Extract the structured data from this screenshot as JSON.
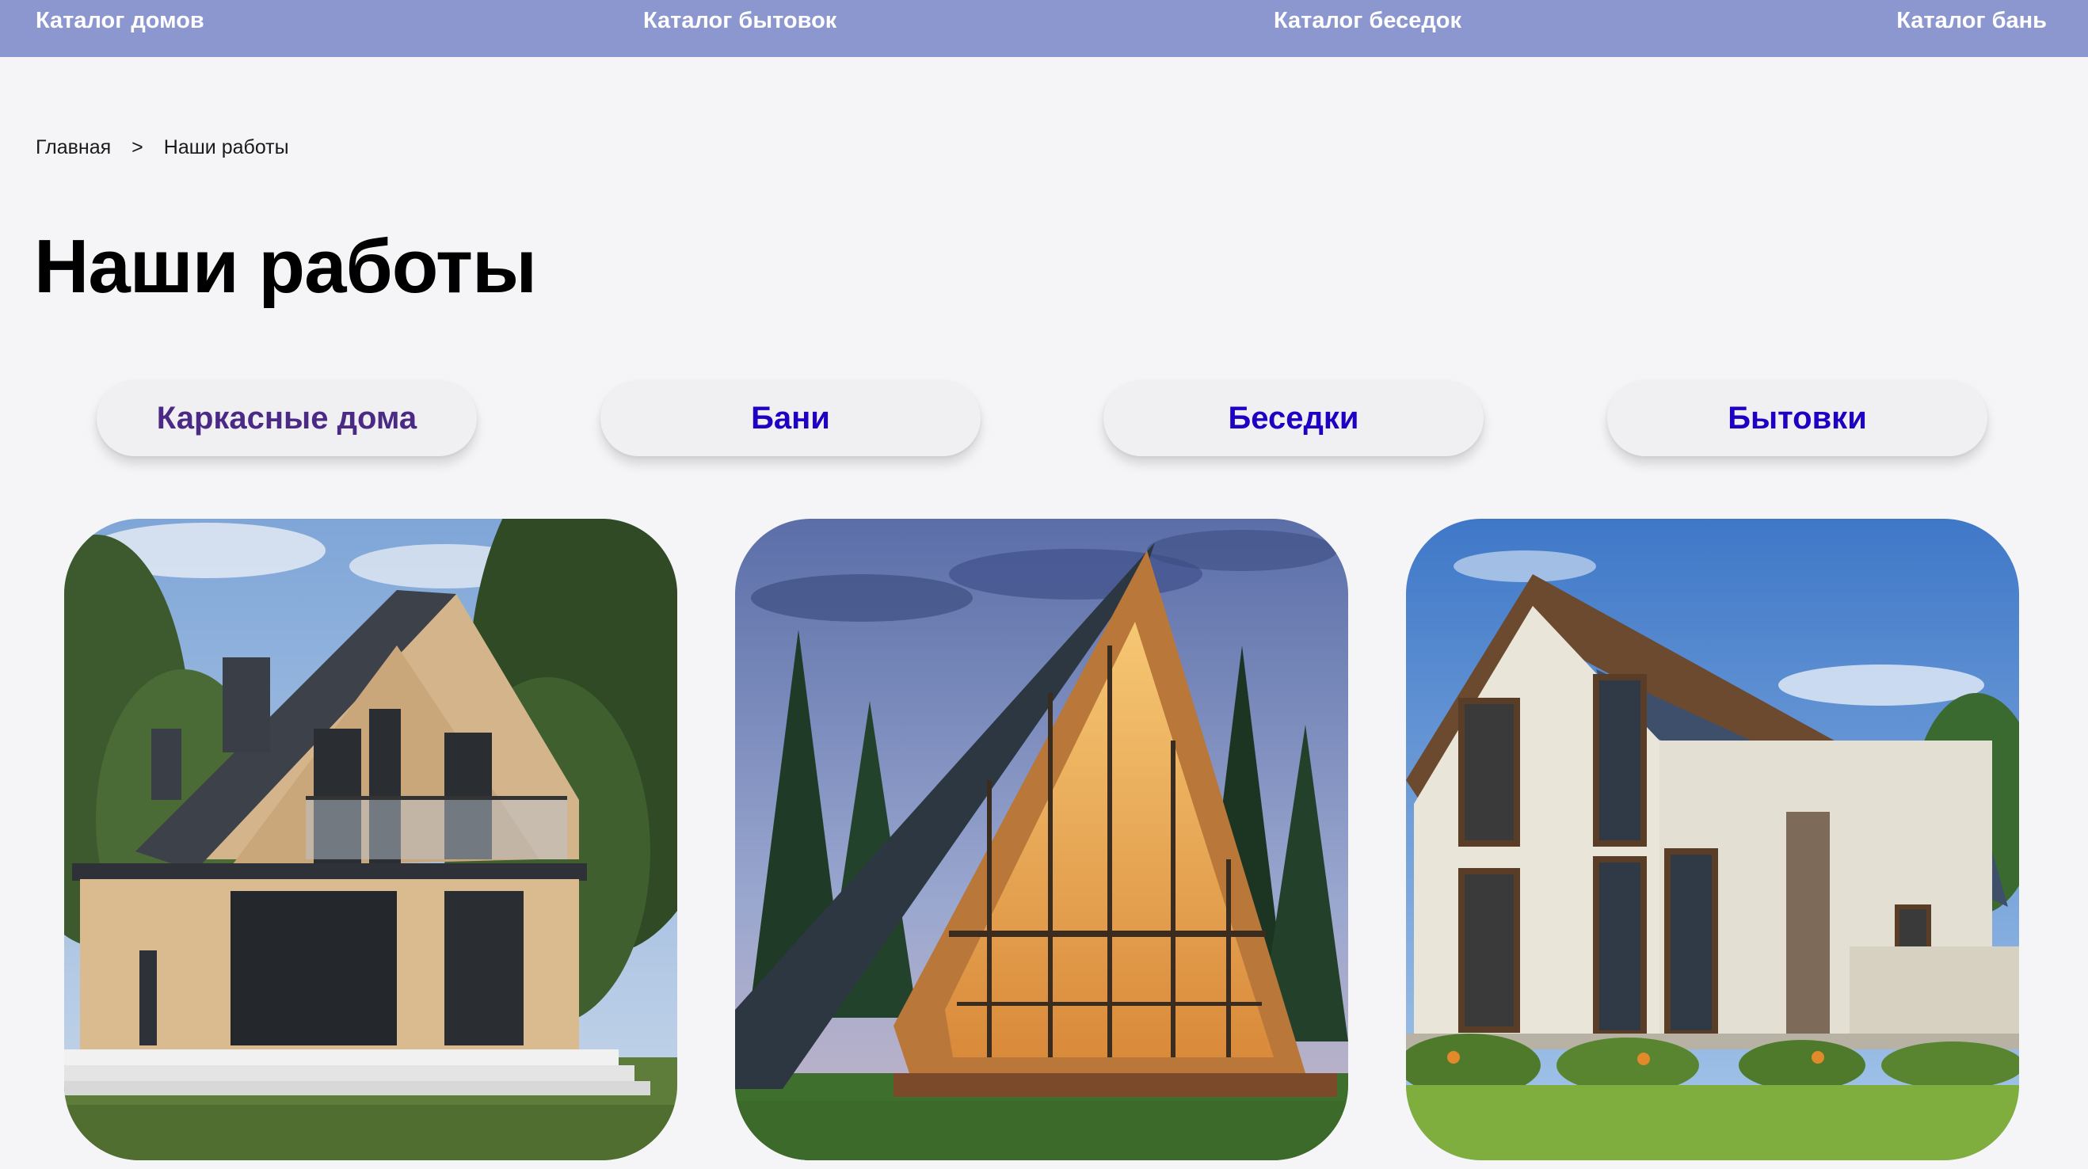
{
  "nav": {
    "items": [
      {
        "label": "Каталог домов"
      },
      {
        "label": "Каталог бытовок"
      },
      {
        "label": "Каталог беседок"
      },
      {
        "label": "Каталог бань"
      }
    ]
  },
  "breadcrumb": {
    "home": "Главная",
    "separator": ">",
    "current": "Наши работы"
  },
  "page": {
    "title": "Наши работы"
  },
  "filters": {
    "tabs": [
      {
        "label": "Каркасные дома",
        "active": true
      },
      {
        "label": "Бани",
        "active": false
      },
      {
        "label": "Беседки",
        "active": false
      },
      {
        "label": "Бытовки",
        "active": false
      }
    ]
  },
  "colors": {
    "nav_bg": "#8d97cf",
    "tab_active": "#4b2a85",
    "tab_text": "#1e00c4",
    "page_bg": "#f5f5f7"
  },
  "gallery": {
    "cards": [
      {
        "image": "frame-house-photo"
      },
      {
        "image": "a-frame-house-photo"
      },
      {
        "image": "stucco-house-photo"
      }
    ]
  }
}
